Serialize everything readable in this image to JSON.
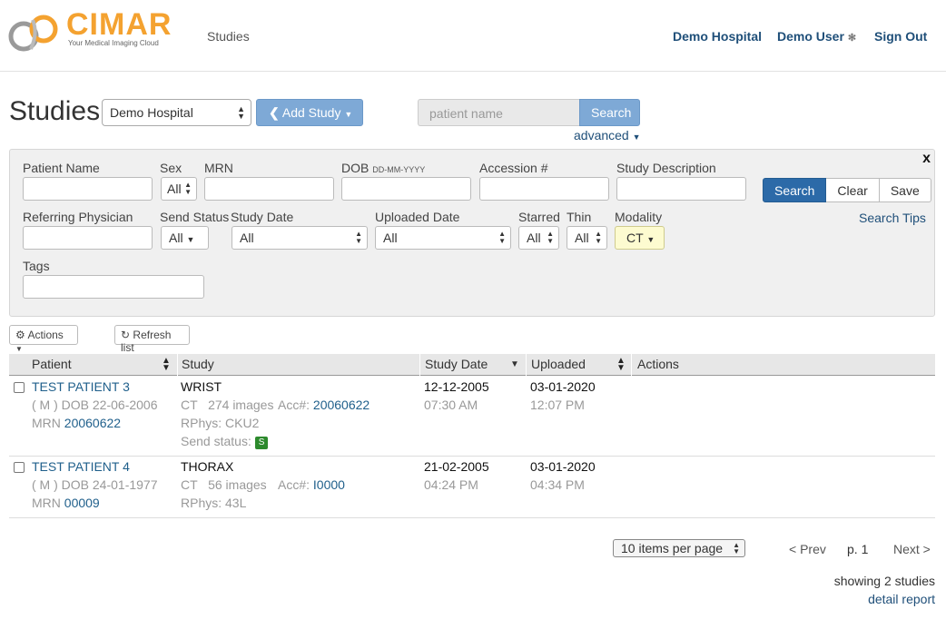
{
  "header": {
    "logo_title": "CIMAR",
    "logo_subtitle": "Your Medical Imaging Cloud",
    "nav_studies": "Studies",
    "hospital": "Demo Hospital",
    "user": "Demo User",
    "sign_out": "Sign Out"
  },
  "toolbar": {
    "title": "Studies",
    "hospital_select": "Demo Hospital",
    "add_study": "Add Study",
    "search_placeholder": "patient name",
    "search_button": "Search",
    "advanced": "advanced"
  },
  "filters": {
    "patient_name": "Patient Name",
    "sex": "Sex",
    "sex_value": "All",
    "mrn": "MRN",
    "dob": "DOB",
    "dob_hint": "DD-MM-YYYY",
    "accession": "Accession #",
    "study_description": "Study Description",
    "search": "Search",
    "clear": "Clear",
    "save": "Save",
    "close": "x",
    "referring_physician": "Referring Physician",
    "send_status": "Send Status",
    "send_status_value": "All",
    "study_date": "Study Date",
    "study_date_value": "All",
    "uploaded_date": "Uploaded Date",
    "uploaded_date_value": "All",
    "starred": "Starred",
    "starred_value": "All",
    "thin": "Thin",
    "thin_value": "All",
    "modality": "Modality",
    "modality_value": "CT",
    "search_tips": "Search Tips",
    "tags": "Tags"
  },
  "list_actions": {
    "actions": "Actions",
    "refresh": "Refresh list"
  },
  "table": {
    "columns": [
      "Patient",
      "Study",
      "Study Date",
      "Uploaded",
      "Actions"
    ],
    "rows": [
      {
        "patient": "TEST PATIENT 3",
        "sex_dob": "( M ) DOB 22-06-2006",
        "mrn_label": "MRN",
        "mrn": "20060622",
        "study": "WRIST",
        "modality_images": "CT   274 images",
        "acc_label": "Acc#:",
        "acc": "20060622",
        "rphys": "RPhys: CKU2",
        "send_status_label": "Send status:",
        "send_status_badge": "S",
        "study_date": "12-12-2005",
        "study_time": "07:30 AM",
        "uploaded_date": "03-01-2020",
        "uploaded_time": "12:07 PM"
      },
      {
        "patient": "TEST PATIENT 4",
        "sex_dob": "( M ) DOB 24-01-1977",
        "mrn_label": "MRN",
        "mrn": "00009",
        "study": "THORAX",
        "modality_images": "CT   56 images",
        "acc_label": "Acc#:",
        "acc": "I0000",
        "rphys": "RPhys: 43L",
        "study_date": "21-02-2005",
        "study_time": "04:24 PM",
        "uploaded_date": "03-01-2020",
        "uploaded_time": "04:34 PM"
      }
    ]
  },
  "footer": {
    "per_page": "10 items per page",
    "prev": "< Prev",
    "page": "p. 1",
    "next": "Next >",
    "showing": "showing 2 studies",
    "detail_report": "detail report"
  }
}
